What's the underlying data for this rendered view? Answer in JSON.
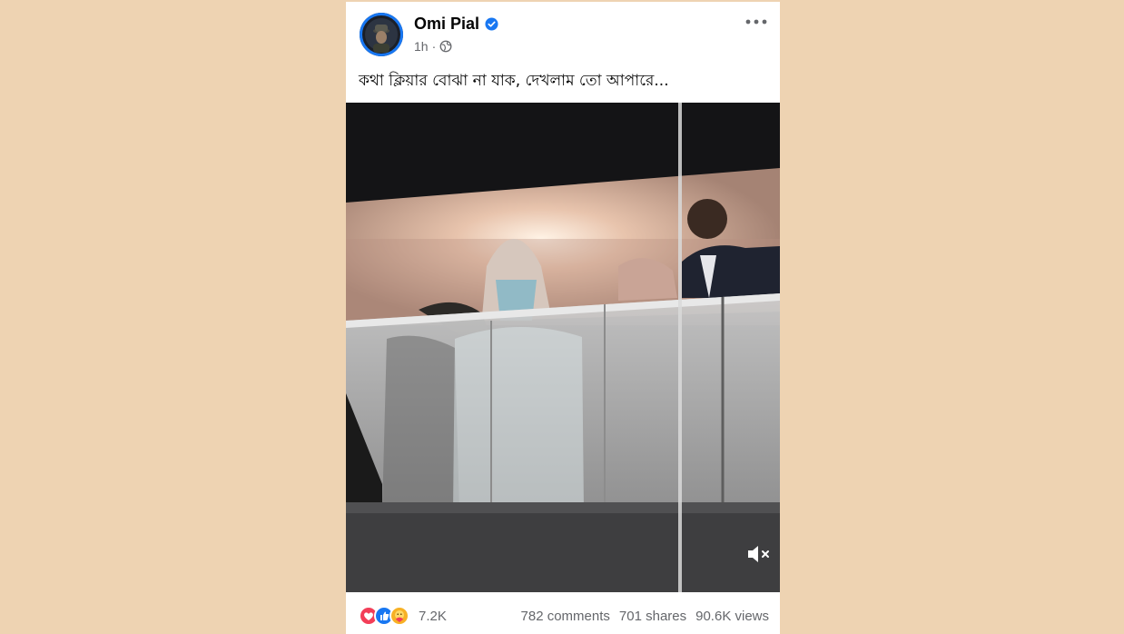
{
  "post": {
    "author": "Omi Pial",
    "time": "1h",
    "caption": "কথা ক্লিয়ার বোঝা না যাক, দেখলাম তো আপারে..."
  },
  "icons": {
    "verified": "verified-badge-icon",
    "privacy": "globe-icon",
    "more": "more-options-icon",
    "mute": "muted-speaker-icon",
    "reactions": [
      "love-reaction-icon",
      "like-reaction-icon",
      "care-reaction-icon"
    ]
  },
  "engagement": {
    "reactions_count": "7.2K",
    "comments": "782 comments",
    "shares": "701 shares",
    "views": "90.6K views"
  },
  "colors": {
    "page_background": "#eed3b2",
    "brand_blue": "#1877f2",
    "text_secondary": "#65676b"
  }
}
